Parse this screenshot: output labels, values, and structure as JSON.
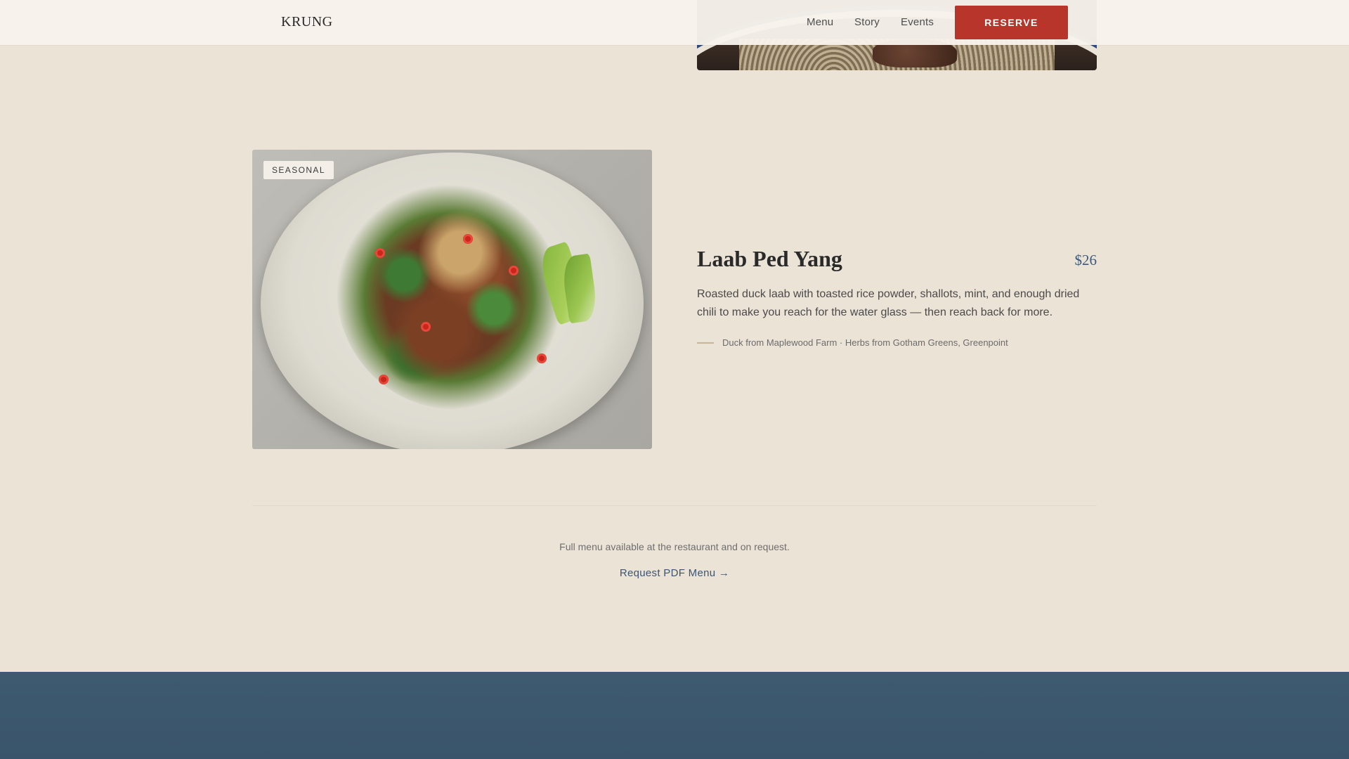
{
  "header": {
    "logo": "KRUNG",
    "nav": [
      "Menu",
      "Story",
      "Events"
    ],
    "reserve_label": "RESERVE"
  },
  "dish": {
    "badge": "SEASONAL",
    "title": "Laab Ped Yang",
    "price": "$26",
    "description": "Roasted duck laab with toasted rice powder, shallots, mint, and enough dried chili to make you reach for the water glass — then reach back for more.",
    "sourcing": "Duck from Maplewood Farm · Herbs from Gotham Greens, Greenpoint"
  },
  "menu_footer": {
    "note": "Full menu available at the restaurant and on request.",
    "pdf_link": "Request PDF Menu →"
  },
  "colors": {
    "background": "#ece3d7",
    "accent": "#b8352b",
    "price": "#3d5a7c",
    "footer": "#3e5a70"
  }
}
